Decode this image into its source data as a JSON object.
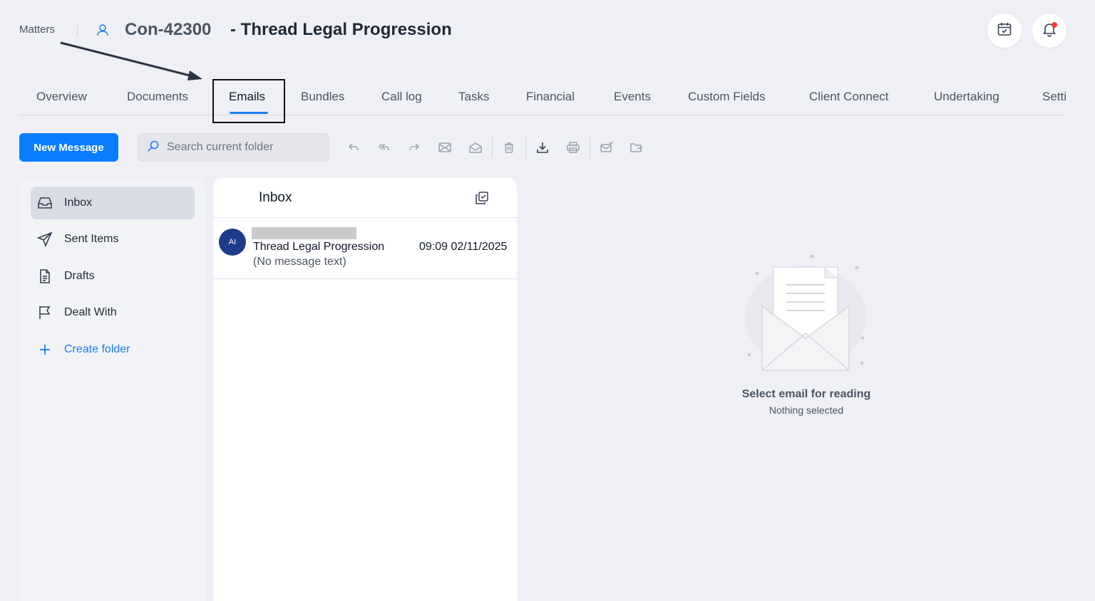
{
  "header": {
    "breadcrumb": "Matters",
    "matter_code": "Con-42300",
    "matter_title": "- Thread Legal Progression"
  },
  "tabs": [
    {
      "label": "Overview"
    },
    {
      "label": "Documents"
    },
    {
      "label": "Emails",
      "active": true
    },
    {
      "label": "Bundles"
    },
    {
      "label": "Call log"
    },
    {
      "label": "Tasks"
    },
    {
      "label": "Financial"
    },
    {
      "label": "Events"
    },
    {
      "label": "Custom Fields"
    },
    {
      "label": "Client Connect"
    },
    {
      "label": "Undertaking"
    },
    {
      "label": "Setti"
    }
  ],
  "toolbar": {
    "new_message_label": "New Message",
    "search_placeholder": "Search current folder",
    "icons": [
      "reply-icon",
      "reply-all-icon",
      "forward-icon",
      "mark-unread-icon",
      "mark-read-icon",
      "delete-icon",
      "download-icon",
      "print-icon",
      "assign-icon",
      "move-folder-icon"
    ]
  },
  "folders": [
    {
      "label": "Inbox",
      "icon": "inbox-icon",
      "active": true
    },
    {
      "label": "Sent Items",
      "icon": "send-icon"
    },
    {
      "label": "Drafts",
      "icon": "document-icon"
    },
    {
      "label": "Dealt With",
      "icon": "flag-icon"
    },
    {
      "label": "Create folder",
      "icon": "plus-icon"
    }
  ],
  "message_list": {
    "title": "Inbox",
    "messages": [
      {
        "avatar_initials": "AI",
        "subject": "Thread Legal Progression",
        "date": "02/11/2025 09:09",
        "preview": "(No message text)"
      }
    ]
  },
  "reading_pane": {
    "title": "Select email for reading",
    "subtitle": "Nothing selected"
  },
  "colors": {
    "accent": "#0a7cff",
    "background": "#eff0f5",
    "avatar": "#1e3a8a",
    "notification": "#ef4444"
  }
}
